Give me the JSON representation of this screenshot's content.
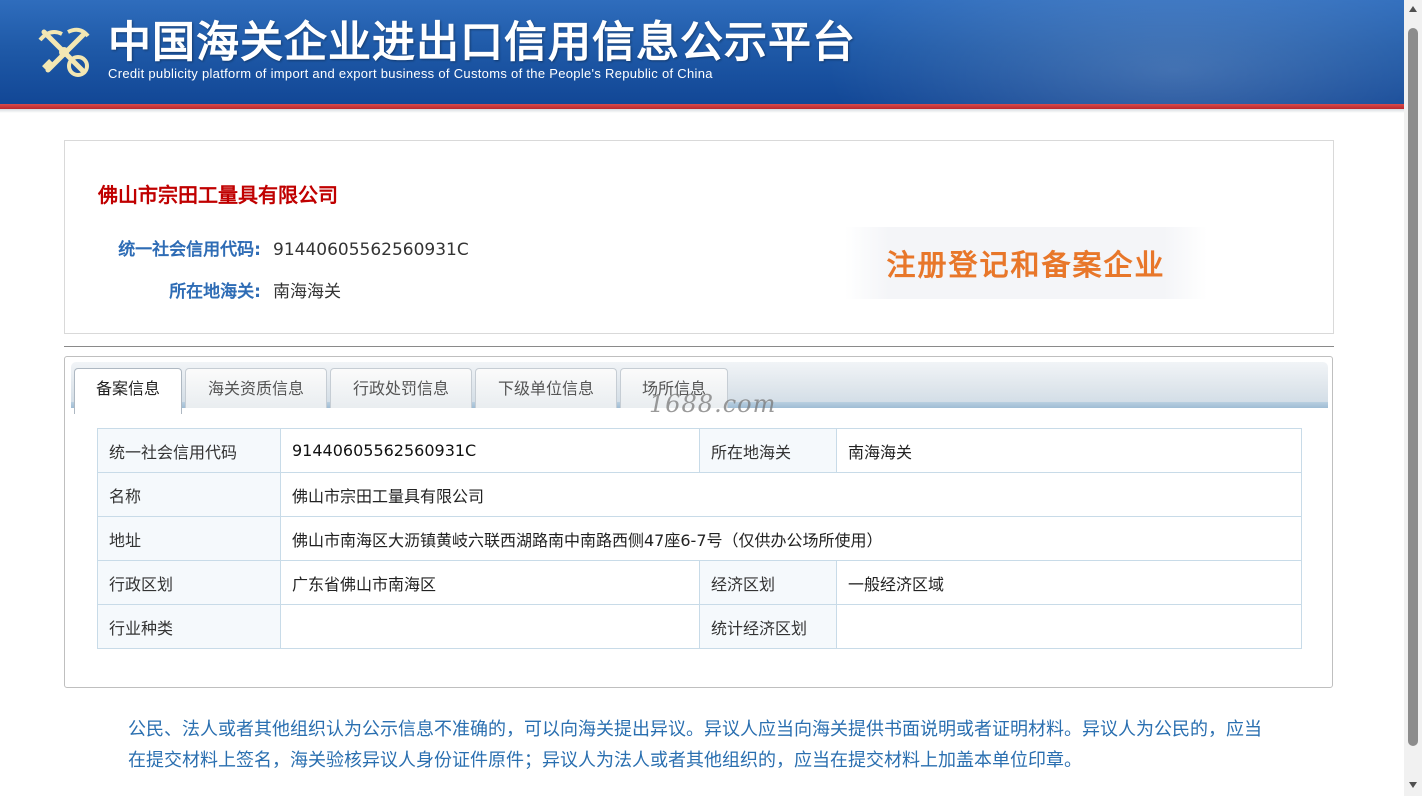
{
  "header": {
    "title": "中国海关企业进出口信用信息公示平台",
    "subtitle": "Credit publicity platform of import and export business of Customs of the People's Republic of China",
    "emblem_icon": "customs-emblem-icon"
  },
  "company": {
    "name": "佛山市宗田工量具有限公司",
    "credit_code_label": "统一社会信用代码:",
    "credit_code_value": "91440605562560931C",
    "customs_label": "所在地海关:",
    "customs_value": "南海海关",
    "status": "注册登记和备案企业"
  },
  "tabs": [
    {
      "label": "备案信息",
      "active": true
    },
    {
      "label": "海关资质信息",
      "active": false
    },
    {
      "label": "行政处罚信息",
      "active": false
    },
    {
      "label": "下级单位信息",
      "active": false
    },
    {
      "label": "场所信息",
      "active": false
    }
  ],
  "watermark": "1688.com",
  "table": {
    "credit_code_label": "统一社会信用代码",
    "credit_code_value": "91440605562560931C",
    "customs_label": "所在地海关",
    "customs_value": "南海海关",
    "name_label": "名称",
    "name_value": "佛山市宗田工量具有限公司",
    "address_label": "地址",
    "address_value": "佛山市南海区大沥镇黄岐六联西湖路南中南路西侧47座6-7号（仅供办公场所使用）",
    "admin_region_label": "行政区划",
    "admin_region_value": "广东省佛山市南海区",
    "econ_region_label": "经济区划",
    "econ_region_value": "一般经济区域",
    "industry_label": "行业种类",
    "industry_value": "",
    "stat_region_label": "统计经济区划",
    "stat_region_value": ""
  },
  "notice": "公民、法人或者其他组织认为公示信息不准确的，可以向海关提出异议。异议人应当向海关提供书面说明或者证明材料。异议人为公民的，应当在提交材料上签名，海关验核异议人身份证件原件；异议人为法人或者其他组织的，应当在提交材料上加盖本单位印章。",
  "colors": {
    "header_blue": "#1f5aa8",
    "header_red_line": "#c0282e",
    "company_name": "#c00000",
    "label_blue": "#2e6cb5",
    "status_orange": "#e8772a",
    "notice_blue": "#2a6fb0"
  }
}
